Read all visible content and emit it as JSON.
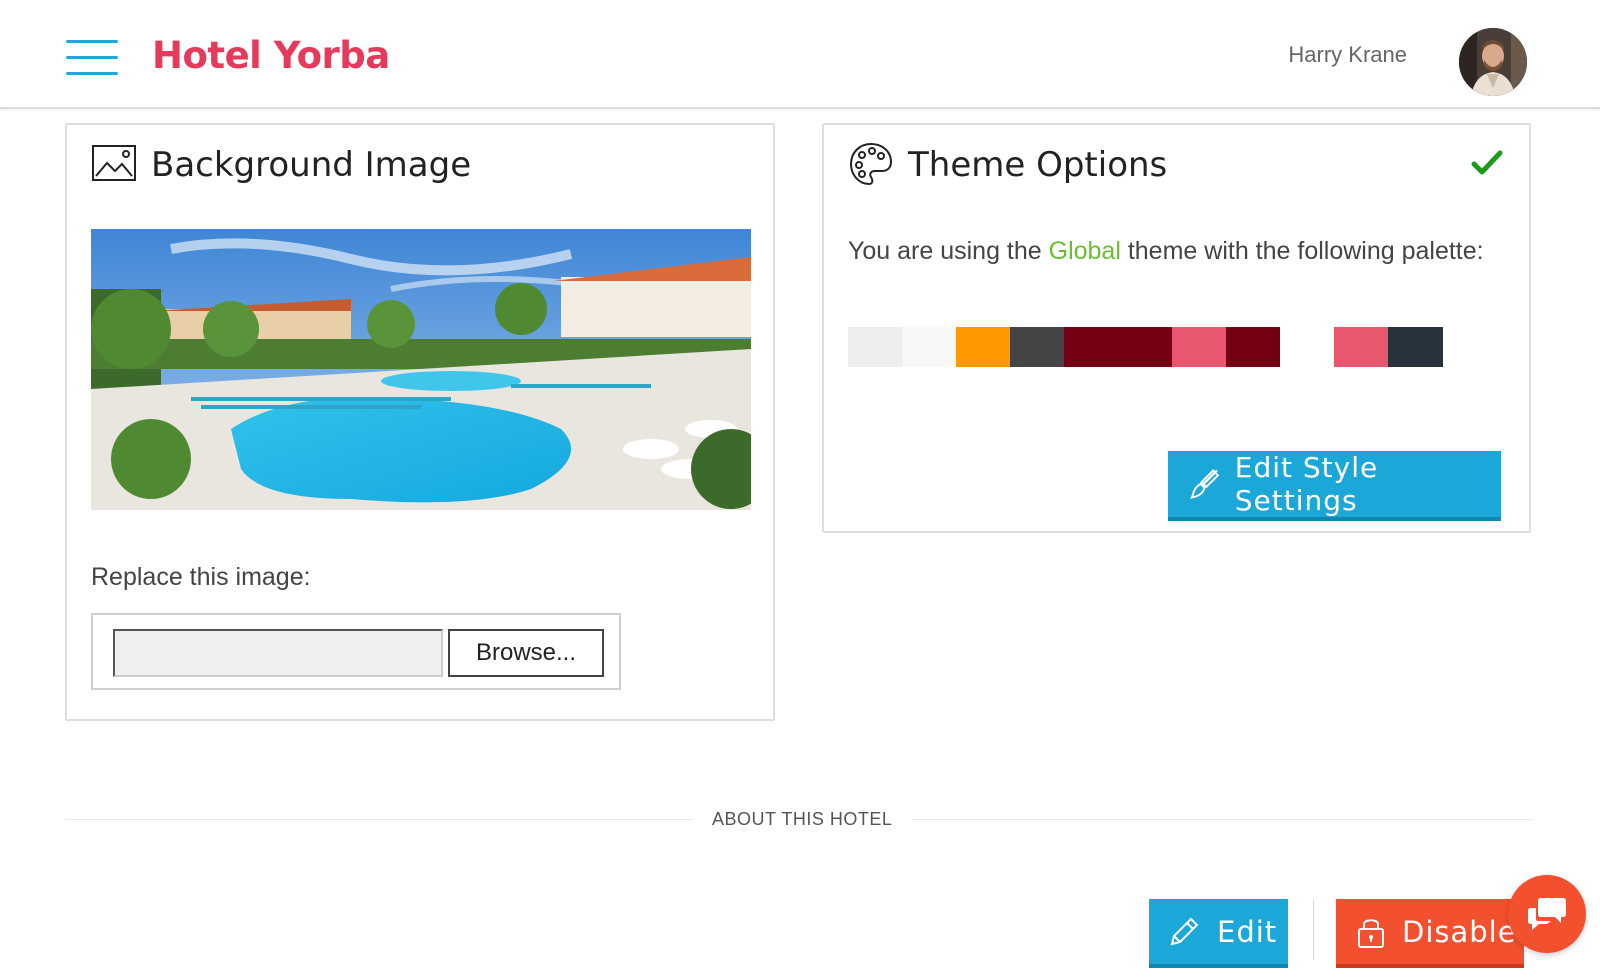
{
  "header": {
    "menu_icon": "hamburger-menu-icon",
    "brand": "Hotel Yorba",
    "user_name": "Harry Krane",
    "avatar_icon": "user-avatar"
  },
  "background_card": {
    "title": "Background Image",
    "icon": "image-icon",
    "photo": "hotel-pool-photo",
    "replace_label": "Replace this image:",
    "file_input_value": "",
    "browse_label": "Browse..."
  },
  "theme_card": {
    "title": "Theme Options",
    "icon": "palette-icon",
    "status_icon": "checkmark-icon",
    "desc_before": "You are using the ",
    "theme_name": "Global",
    "desc_after": " theme with the following palette:",
    "palette": [
      "#eeeeee",
      "#f8f8f8",
      "#ff9900",
      "#444444",
      "#750014",
      "#750014",
      "#e95670",
      "#750014",
      "#ffffff",
      "#e95670",
      "#28323c"
    ],
    "edit_style_label": "Edit Style Settings",
    "edit_style_icon": "paintbrush-icon"
  },
  "about_section": {
    "label": "ABOUT THIS HOTEL"
  },
  "actions": {
    "edit_label": "Edit",
    "edit_icon": "pencil-icon",
    "disable_label": "Disable",
    "disable_icon": "lock-icon",
    "chat_icon": "chat-bubbles-icon"
  },
  "colors": {
    "brand": "#e63a5c",
    "primary": "#1ca7d9",
    "danger": "#f2502f",
    "accent_green": "#6bbf2f"
  }
}
